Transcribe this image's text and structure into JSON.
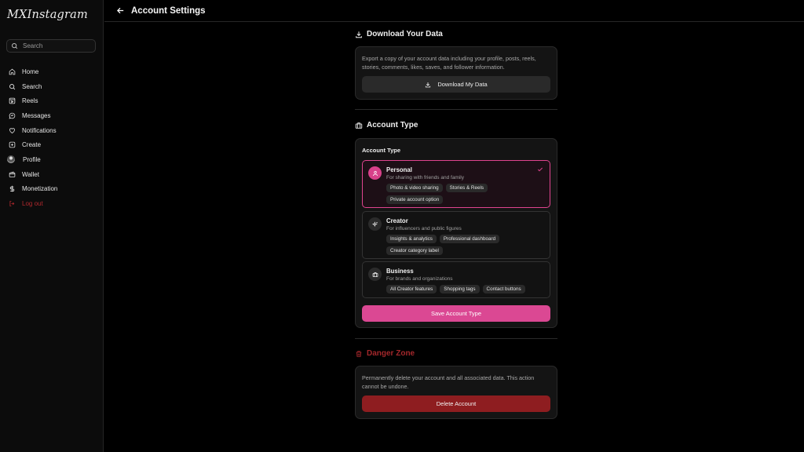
{
  "app": {
    "logo": "MXInstagram"
  },
  "sidebar": {
    "search_placeholder": "Search",
    "items": [
      {
        "label": "Home",
        "icon": "home-icon"
      },
      {
        "label": "Search",
        "icon": "search-icon"
      },
      {
        "label": "Reels",
        "icon": "reels-icon"
      },
      {
        "label": "Messages",
        "icon": "message-icon"
      },
      {
        "label": "Notifications",
        "icon": "heart-icon"
      },
      {
        "label": "Create",
        "icon": "plus-square-icon"
      },
      {
        "label": "Profile",
        "icon": "avatar"
      },
      {
        "label": "Wallet",
        "icon": "wallet-icon"
      },
      {
        "label": "Monetization",
        "icon": "dollar-icon"
      },
      {
        "label": "Log out",
        "icon": "logout-icon"
      }
    ]
  },
  "header": {
    "title": "Account Settings"
  },
  "download": {
    "title": "Download Your Data",
    "description": "Export a copy of your account data including your profile, posts, reels, stories, comments, likes, saves, and follower information.",
    "button": "Download My Data"
  },
  "account_type": {
    "title": "Account Type",
    "card_label": "Account Type",
    "options": [
      {
        "name": "Personal",
        "subtitle": "For sharing with friends and family",
        "features": [
          "Photo & video sharing",
          "Stories & Reels",
          "Private account option"
        ],
        "selected": true
      },
      {
        "name": "Creator",
        "subtitle": "For influencers and public figures",
        "features": [
          "Insights & analytics",
          "Professional dashboard",
          "Creator category label"
        ],
        "selected": false
      },
      {
        "name": "Business",
        "subtitle": "For brands and organizations",
        "features": [
          "All Creator features",
          "Shopping tags",
          "Contact buttons"
        ],
        "selected": false
      }
    ],
    "save_button": "Save Account Type"
  },
  "danger": {
    "title": "Danger Zone",
    "description": "Permanently delete your account and all associated data. This action cannot be undone.",
    "button": "Delete Account"
  },
  "colors": {
    "accent": "#db4893",
    "danger": "#8e1d20",
    "danger_text": "#b0282d",
    "background": "#000000"
  }
}
